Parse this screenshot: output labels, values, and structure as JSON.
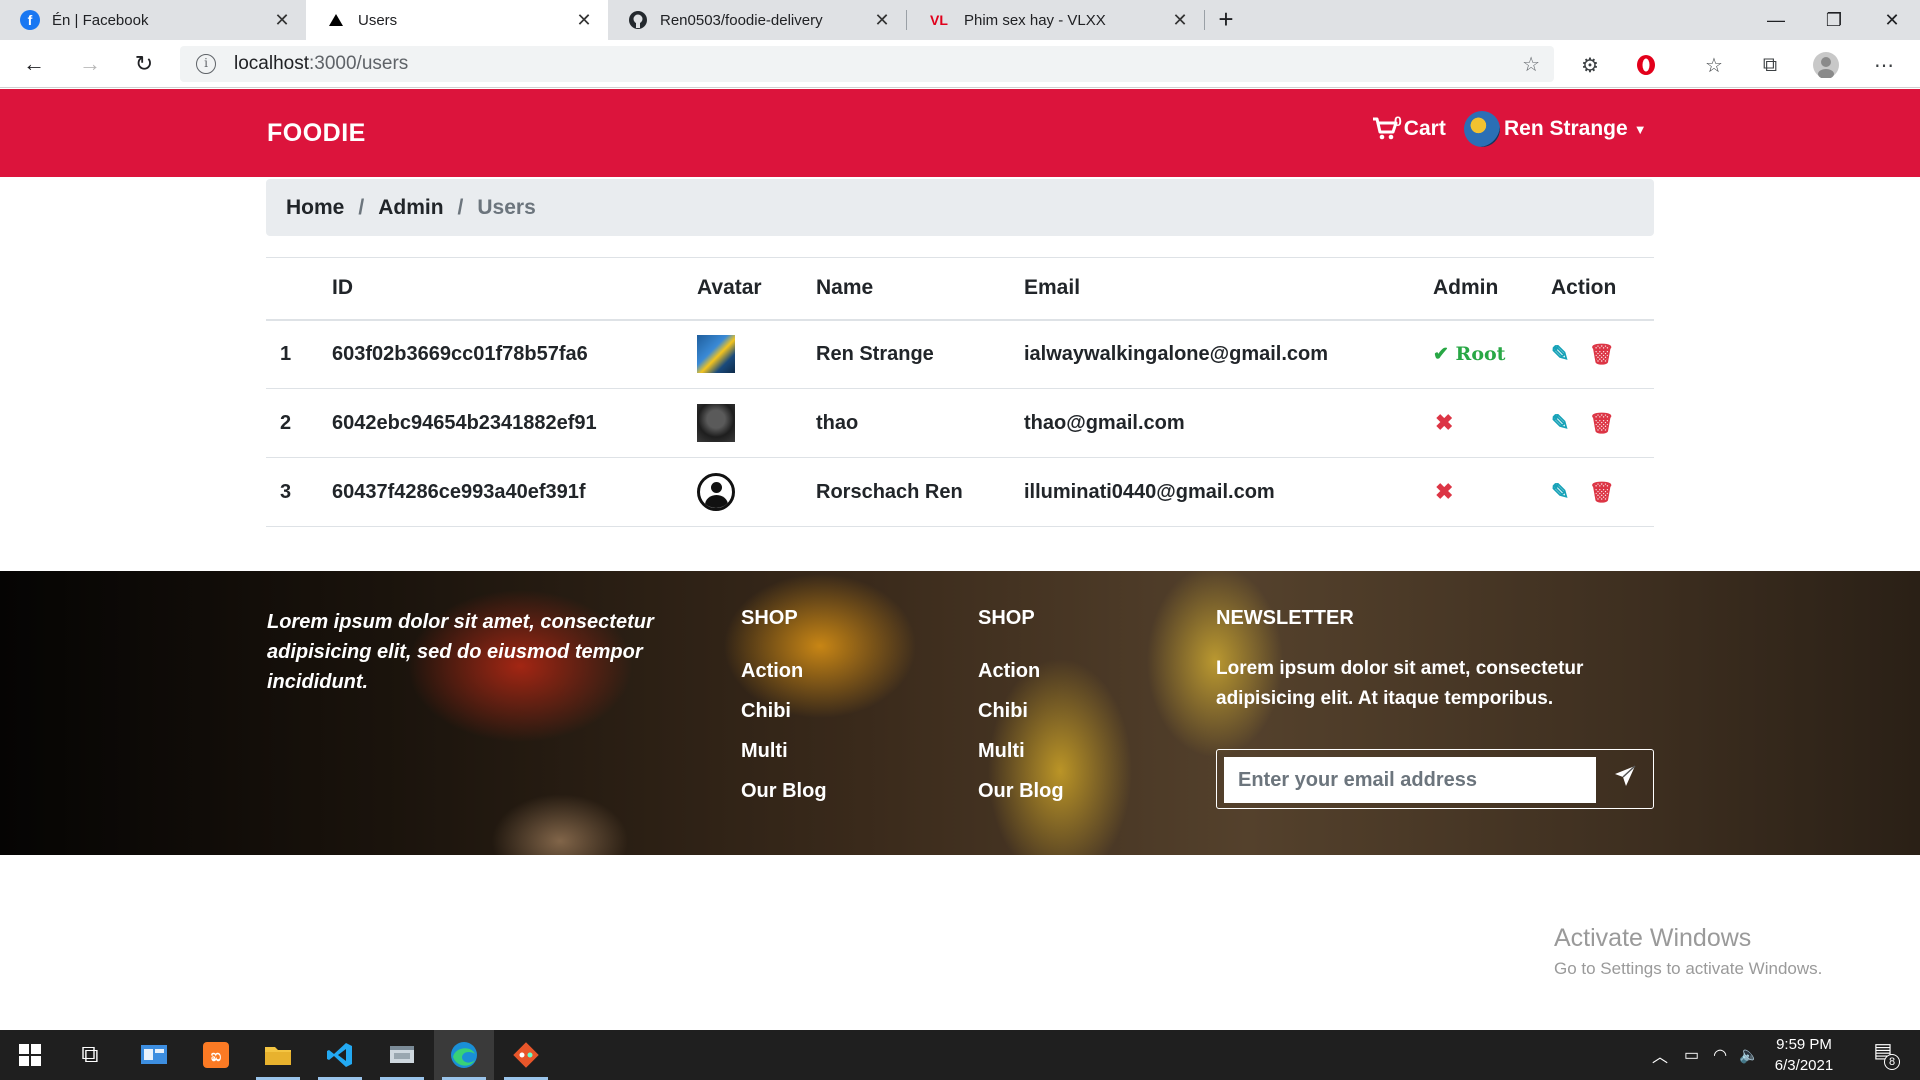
{
  "browser": {
    "tabs": [
      {
        "title": "Én | Facebook",
        "icon": "facebook-icon",
        "active": false
      },
      {
        "title": "Users",
        "icon": "triangle-icon",
        "active": true
      },
      {
        "title": "Ren0503/foodie-delivery",
        "icon": "github-icon",
        "active": false
      },
      {
        "title": "Phim sex hay - VLXX",
        "icon": "vl-icon",
        "icon_text": "VL",
        "active": false
      }
    ],
    "url_host": "localhost",
    "url_path": ":3000/users"
  },
  "navbar": {
    "brand": "FOODIE",
    "cart_count": "0",
    "cart_label": "Cart",
    "user_name": "Ren Strange",
    "color": "#dc143c"
  },
  "breadcrumb": {
    "items": [
      "Home",
      "Admin"
    ],
    "active": "Users"
  },
  "table": {
    "headers": [
      "",
      "ID",
      "Avatar",
      "Name",
      "Email",
      "Admin",
      "Action"
    ],
    "rows": [
      {
        "index": "1",
        "id": "603f02b3669cc01f78b57fa6",
        "avatar": "photo-avatar",
        "name": "Ren Strange",
        "email": "ialwaywalkingalone@gmail.com",
        "admin": true,
        "admin_label": "Root"
      },
      {
        "index": "2",
        "id": "6042ebc94654b2341882ef91",
        "avatar": "photo-avatar",
        "name": "thao",
        "email": "thao@gmail.com",
        "admin": false,
        "admin_label": ""
      },
      {
        "index": "3",
        "id": "60437f4286ce993a40ef391f",
        "avatar": "default-user-icon",
        "name": "Rorschach Ren",
        "email": "illuminati0440@gmail.com",
        "admin": false,
        "admin_label": ""
      }
    ]
  },
  "footer": {
    "about": "Lorem ipsum dolor sit amet, consectetur adipisicing elit, sed do eiusmod tempor incididunt.",
    "col1": {
      "heading": "SHOP",
      "links": [
        "Action",
        "Chibi",
        "Multi",
        "Our Blog"
      ]
    },
    "col2": {
      "heading": "SHOP",
      "links": [
        "Action",
        "Chibi",
        "Multi",
        "Our Blog"
      ]
    },
    "newsletter": {
      "heading": "NEWSLETTER",
      "text": "Lorem ipsum dolor sit amet, consectetur adipisicing elit. At itaque temporibus.",
      "placeholder": "Enter your email address"
    }
  },
  "watermark": {
    "line1": "Activate Windows",
    "line2": "Go to Settings to activate Windows."
  },
  "taskbar": {
    "time": "9:59 PM",
    "date": "6/3/2021",
    "notification_count": "8"
  }
}
